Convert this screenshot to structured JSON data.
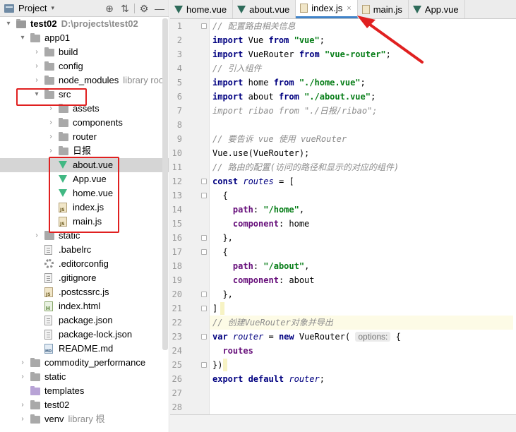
{
  "panel": {
    "title": "Project",
    "caret": "▾",
    "tools": [
      "⊕",
      "⇅",
      "⚙",
      "—"
    ]
  },
  "tree": [
    {
      "label": "test02",
      "hint": "D:\\projects\\test02",
      "bold": true,
      "icon": "folder-root",
      "depth": 0,
      "arrow": "▾"
    },
    {
      "label": "app01",
      "hint": "",
      "icon": "folder",
      "depth": 1,
      "arrow": "▾"
    },
    {
      "label": "build",
      "hint": "",
      "icon": "folder",
      "depth": 2,
      "arrow": "›"
    },
    {
      "label": "config",
      "hint": "",
      "icon": "folder",
      "depth": 2,
      "arrow": "›"
    },
    {
      "label": "node_modules",
      "hint": "library roo",
      "icon": "folder",
      "depth": 2,
      "arrow": "›"
    },
    {
      "label": "src",
      "hint": "",
      "icon": "folder",
      "depth": 2,
      "arrow": "▾"
    },
    {
      "label": "assets",
      "hint": "",
      "icon": "folder",
      "depth": 3,
      "arrow": "›"
    },
    {
      "label": "components",
      "hint": "",
      "icon": "folder",
      "depth": 3,
      "arrow": "›"
    },
    {
      "label": "router",
      "hint": "",
      "icon": "folder",
      "depth": 3,
      "arrow": "›"
    },
    {
      "label": "日报",
      "hint": "",
      "icon": "folder",
      "depth": 3,
      "arrow": "›"
    },
    {
      "label": "about.vue",
      "hint": "",
      "icon": "vue",
      "depth": 3,
      "arrow": "",
      "selected": true
    },
    {
      "label": "App.vue",
      "hint": "",
      "icon": "vue",
      "depth": 3,
      "arrow": ""
    },
    {
      "label": "home.vue",
      "hint": "",
      "icon": "vue",
      "depth": 3,
      "arrow": ""
    },
    {
      "label": "index.js",
      "hint": "",
      "icon": "js",
      "depth": 3,
      "arrow": ""
    },
    {
      "label": "main.js",
      "hint": "",
      "icon": "js",
      "depth": 3,
      "arrow": ""
    },
    {
      "label": "static",
      "hint": "",
      "icon": "folder",
      "depth": 2,
      "arrow": "›"
    },
    {
      "label": ".babelrc",
      "hint": "",
      "icon": "doc",
      "depth": 2,
      "arrow": ""
    },
    {
      "label": ".editorconfig",
      "hint": "",
      "icon": "gear",
      "depth": 2,
      "arrow": ""
    },
    {
      "label": ".gitignore",
      "hint": "",
      "icon": "doc",
      "depth": 2,
      "arrow": ""
    },
    {
      "label": ".postcssrc.js",
      "hint": "",
      "icon": "js",
      "depth": 2,
      "arrow": ""
    },
    {
      "label": "index.html",
      "hint": "",
      "icon": "html",
      "depth": 2,
      "arrow": ""
    },
    {
      "label": "package.json",
      "hint": "",
      "icon": "doc",
      "depth": 2,
      "arrow": ""
    },
    {
      "label": "package-lock.json",
      "hint": "",
      "icon": "doc",
      "depth": 2,
      "arrow": ""
    },
    {
      "label": "README.md",
      "hint": "",
      "icon": "md",
      "depth": 2,
      "arrow": ""
    },
    {
      "label": "commodity_performance",
      "hint": "",
      "icon": "folder",
      "depth": 1,
      "arrow": "›"
    },
    {
      "label": "static",
      "hint": "",
      "icon": "folder",
      "depth": 1,
      "arrow": "›"
    },
    {
      "label": "templates",
      "hint": "",
      "icon": "folder-purple",
      "depth": 1,
      "arrow": ""
    },
    {
      "label": "test02",
      "hint": "",
      "icon": "folder",
      "depth": 1,
      "arrow": "›"
    },
    {
      "label": "venv",
      "hint": "library 根",
      "icon": "folder",
      "depth": 1,
      "arrow": "›"
    }
  ],
  "tabs": [
    {
      "label": "home.vue",
      "icon": "vue",
      "active": false,
      "close": ""
    },
    {
      "label": "about.vue",
      "icon": "vue",
      "active": false,
      "close": ""
    },
    {
      "label": "index.js",
      "icon": "js",
      "active": true,
      "close": "×"
    },
    {
      "label": "main.js",
      "icon": "js",
      "active": false,
      "close": ""
    },
    {
      "label": "App.vue",
      "icon": "vue",
      "active": false,
      "close": ""
    }
  ],
  "code": [
    [
      [
        "cm",
        "// 配置路由相关信息"
      ]
    ],
    [
      [
        "kw",
        "import "
      ],
      [
        "plain",
        "Vue "
      ],
      [
        "kw",
        "from "
      ],
      [
        "str",
        "\"vue\""
      ],
      [
        "plain",
        ";"
      ]
    ],
    [
      [
        "kw",
        "import "
      ],
      [
        "plain",
        "VueRouter "
      ],
      [
        "kw",
        "from "
      ],
      [
        "str",
        "\"vue-router\""
      ],
      [
        "plain",
        ";"
      ]
    ],
    [
      [
        "cm",
        "// 引入组件"
      ]
    ],
    [
      [
        "kw",
        "import "
      ],
      [
        "plain",
        "home "
      ],
      [
        "kw",
        "from "
      ],
      [
        "str",
        "\"./home.vue\""
      ],
      [
        "plain",
        ";"
      ]
    ],
    [
      [
        "kw",
        "import "
      ],
      [
        "plain",
        "about "
      ],
      [
        "kw",
        "from "
      ],
      [
        "str",
        "\"./about.vue\""
      ],
      [
        "plain",
        ";"
      ]
    ],
    [
      [
        "cm",
        "import ribao from \"./日报/ribao\";"
      ]
    ],
    [],
    [
      [
        "cm",
        "// 要告诉 vue 使用 vueRouter"
      ]
    ],
    [
      [
        "plain",
        "Vue.use(VueRouter);"
      ]
    ],
    [
      [
        "cm",
        "// 路由的配置(访问的路径和显示的对应的组件)"
      ]
    ],
    [
      [
        "kw",
        "const "
      ],
      [
        "vr",
        "routes"
      ],
      [
        "plain",
        " = ["
      ]
    ],
    [
      [
        "plain",
        "  {"
      ]
    ],
    [
      [
        "plain",
        "    "
      ],
      [
        "prop",
        "path"
      ],
      [
        "plain",
        ": "
      ],
      [
        "str",
        "\"/home\""
      ],
      [
        "plain",
        ","
      ]
    ],
    [
      [
        "plain",
        "    "
      ],
      [
        "prop",
        "component"
      ],
      [
        "plain",
        ": home"
      ]
    ],
    [
      [
        "plain",
        "  },"
      ]
    ],
    [
      [
        "plain",
        "  {"
      ]
    ],
    [
      [
        "plain",
        "    "
      ],
      [
        "prop",
        "path"
      ],
      [
        "plain",
        ": "
      ],
      [
        "str",
        "\"/about\""
      ],
      [
        "plain",
        ","
      ]
    ],
    [
      [
        "plain",
        "    "
      ],
      [
        "prop",
        "component"
      ],
      [
        "plain",
        ": about"
      ]
    ],
    [
      [
        "plain",
        "  },"
      ]
    ],
    [
      [
        "plain",
        "]"
      ]
    ],
    [
      [
        "cm",
        "// 创建VueRouter对象并导出"
      ]
    ],
    [
      [
        "kw",
        "var "
      ],
      [
        "vr",
        "router"
      ],
      [
        "plain",
        " = "
      ],
      [
        "kw",
        "new "
      ],
      [
        "plain",
        "VueRouter( "
      ],
      [
        "hint",
        "options:"
      ],
      [
        "plain",
        " {"
      ]
    ],
    [
      [
        "plain",
        "  "
      ],
      [
        "prop",
        "routes"
      ]
    ],
    [
      [
        "plain",
        "})"
      ]
    ],
    [
      [
        "kw",
        "export default "
      ],
      [
        "vr",
        "router"
      ],
      [
        "plain",
        ";"
      ]
    ],
    [],
    []
  ],
  "highlight_line": 22,
  "colors": {
    "annotation_red": "#e02020",
    "vue_green": "#41b883",
    "active_tab_underline": "#4083c9"
  }
}
